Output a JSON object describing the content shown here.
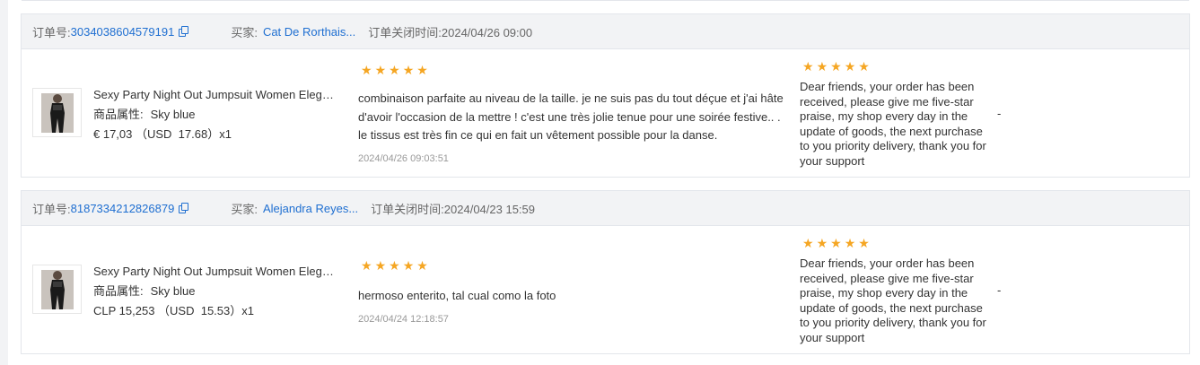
{
  "labels": {
    "order_no": "订单号:",
    "buyer": "买家:",
    "close_time_prefix": "订单关闭时间:",
    "attr": "商品属性:"
  },
  "orders": [
    {
      "order_no": "3034038604579191",
      "buyer": "Cat De Rorthais...",
      "close_time": "2024/04/26 09:00",
      "product_title": "Sexy Party Night Out Jumpsuit Women Elegant",
      "attr_value": "Sky blue",
      "price": "€ 17,03 （USD  17.68）x1",
      "review_stars": 5,
      "review_text": "combinaison parfaite au niveau de la taille. je ne suis pas du tout déçue et j'ai hâte d'avoir l'occasion de la mettre ! c'est une très jolie tenue pour une soirée festive.. . le tissus est très fin ce qui en fait un vêtement possible pour la danse.",
      "review_time": "2024/04/26 09:03:51",
      "reply_stars": 5,
      "reply_text": "Dear friends, your order has been received, please give me five-star praise, my shop every day in the update of goods, the next purchase to you priority delivery, thank you for your support",
      "extra": "-"
    },
    {
      "order_no": "8187334212826879",
      "buyer": "Alejandra Reyes...",
      "close_time": "2024/04/23 15:59",
      "product_title": "Sexy Party Night Out Jumpsuit Women Elegant",
      "attr_value": "Sky blue",
      "price": "CLP 15,253 （USD  15.53）x1",
      "review_stars": 5,
      "review_text": "hermoso enterito, tal cual como la foto",
      "review_time": "2024/04/24 12:18:57",
      "reply_stars": 5,
      "reply_text": "Dear friends, your order has been received, please give me five-star praise, my shop every day in the update of goods, the next purchase to you priority delivery, thank you for your support",
      "extra": "-"
    }
  ],
  "icons": {
    "copy": "copy-icon",
    "star": "star-icon"
  },
  "colors": {
    "link": "#1f6fd1",
    "star": "#f5a623",
    "header_bg": "#f2f3f5",
    "muted": "#999999"
  }
}
